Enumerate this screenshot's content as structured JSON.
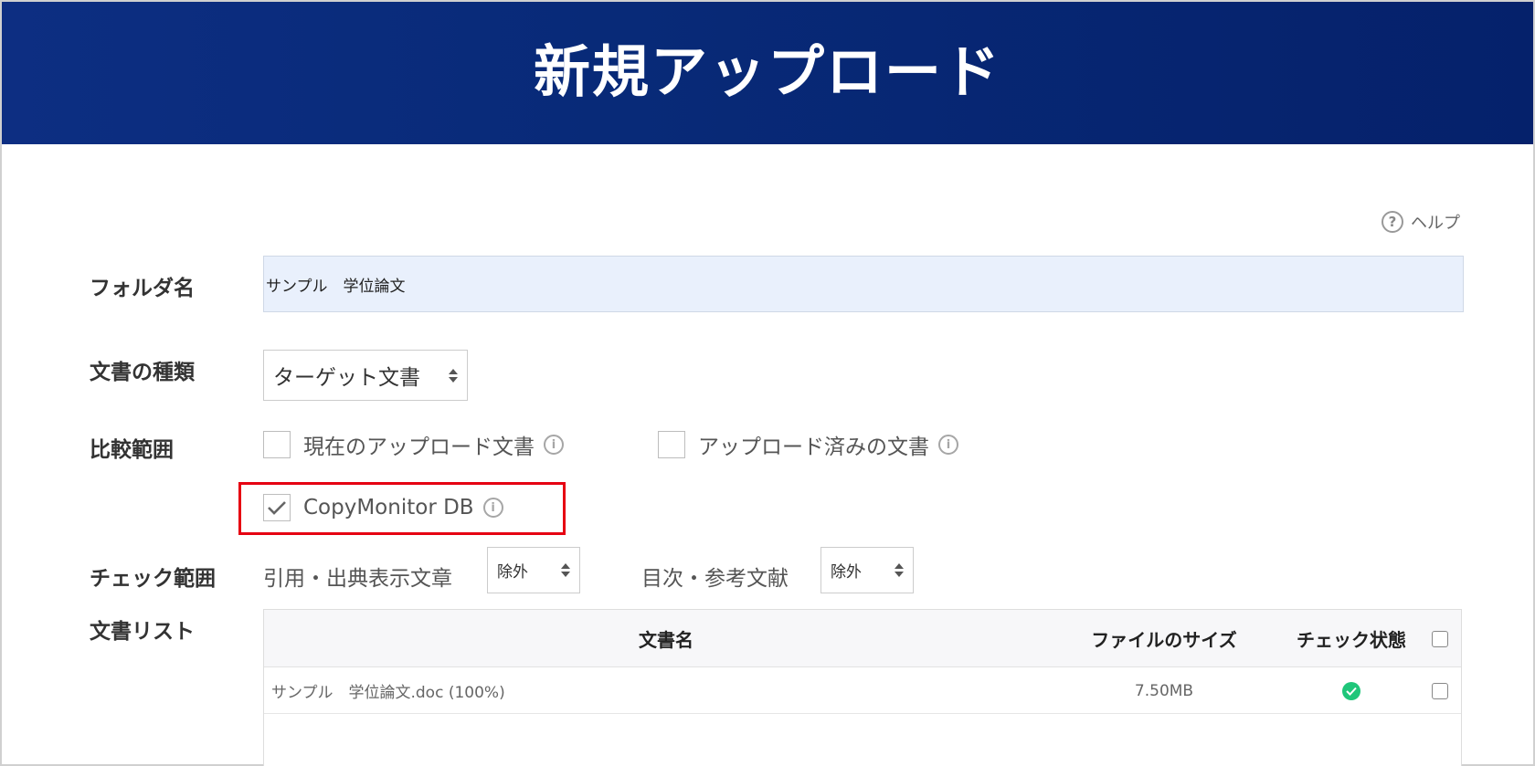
{
  "header": {
    "title": "新規アップロード"
  },
  "help": {
    "label": "ヘルプ",
    "icon": "help-circle-icon"
  },
  "form": {
    "folder_name": {
      "label": "フォルダ名",
      "value": "サンプル　学位論文"
    },
    "doc_type": {
      "label": "文書の種類",
      "selected": "ターゲット文書"
    },
    "compare_range": {
      "label": "比較範囲",
      "options": [
        {
          "label": "現在のアップロード文書",
          "checked": false
        },
        {
          "label": "アップロード済みの文書",
          "checked": false
        },
        {
          "label": "CopyMonitor DB",
          "checked": true
        }
      ]
    },
    "check_range": {
      "label": "チェック範囲",
      "citation": {
        "label": "引用・出典表示文章",
        "selected": "除外"
      },
      "toc": {
        "label": "目次・参考文献",
        "selected": "除外"
      }
    },
    "doc_list": {
      "label": "文書リスト",
      "columns": [
        "文書名",
        "ファイルのサイズ",
        "チェック状態"
      ],
      "rows": [
        {
          "name": "サンプル　学位論文.doc (100%)",
          "size": "7.50MB",
          "status": "ok"
        }
      ]
    }
  },
  "colors": {
    "header": "#082a78",
    "highlight": "#e60012",
    "status_ok": "#1fc67a",
    "input_bg": "#e9f0fc"
  }
}
